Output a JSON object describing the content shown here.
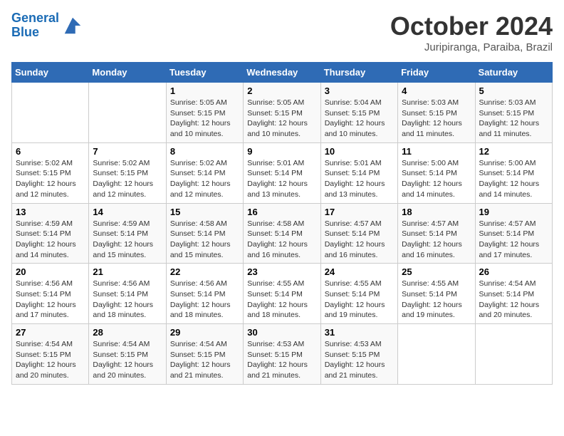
{
  "header": {
    "logo_line1": "General",
    "logo_line2": "Blue",
    "month_title": "October 2024",
    "location": "Juripiranga, Paraiba, Brazil"
  },
  "weekdays": [
    "Sunday",
    "Monday",
    "Tuesday",
    "Wednesday",
    "Thursday",
    "Friday",
    "Saturday"
  ],
  "weeks": [
    [
      {
        "day": "",
        "info": ""
      },
      {
        "day": "",
        "info": ""
      },
      {
        "day": "1",
        "info": "Sunrise: 5:05 AM\nSunset: 5:15 PM\nDaylight: 12 hours and 10 minutes."
      },
      {
        "day": "2",
        "info": "Sunrise: 5:05 AM\nSunset: 5:15 PM\nDaylight: 12 hours and 10 minutes."
      },
      {
        "day": "3",
        "info": "Sunrise: 5:04 AM\nSunset: 5:15 PM\nDaylight: 12 hours and 10 minutes."
      },
      {
        "day": "4",
        "info": "Sunrise: 5:03 AM\nSunset: 5:15 PM\nDaylight: 12 hours and 11 minutes."
      },
      {
        "day": "5",
        "info": "Sunrise: 5:03 AM\nSunset: 5:15 PM\nDaylight: 12 hours and 11 minutes."
      }
    ],
    [
      {
        "day": "6",
        "info": "Sunrise: 5:02 AM\nSunset: 5:15 PM\nDaylight: 12 hours and 12 minutes."
      },
      {
        "day": "7",
        "info": "Sunrise: 5:02 AM\nSunset: 5:15 PM\nDaylight: 12 hours and 12 minutes."
      },
      {
        "day": "8",
        "info": "Sunrise: 5:02 AM\nSunset: 5:14 PM\nDaylight: 12 hours and 12 minutes."
      },
      {
        "day": "9",
        "info": "Sunrise: 5:01 AM\nSunset: 5:14 PM\nDaylight: 12 hours and 13 minutes."
      },
      {
        "day": "10",
        "info": "Sunrise: 5:01 AM\nSunset: 5:14 PM\nDaylight: 12 hours and 13 minutes."
      },
      {
        "day": "11",
        "info": "Sunrise: 5:00 AM\nSunset: 5:14 PM\nDaylight: 12 hours and 14 minutes."
      },
      {
        "day": "12",
        "info": "Sunrise: 5:00 AM\nSunset: 5:14 PM\nDaylight: 12 hours and 14 minutes."
      }
    ],
    [
      {
        "day": "13",
        "info": "Sunrise: 4:59 AM\nSunset: 5:14 PM\nDaylight: 12 hours and 14 minutes."
      },
      {
        "day": "14",
        "info": "Sunrise: 4:59 AM\nSunset: 5:14 PM\nDaylight: 12 hours and 15 minutes."
      },
      {
        "day": "15",
        "info": "Sunrise: 4:58 AM\nSunset: 5:14 PM\nDaylight: 12 hours and 15 minutes."
      },
      {
        "day": "16",
        "info": "Sunrise: 4:58 AM\nSunset: 5:14 PM\nDaylight: 12 hours and 16 minutes."
      },
      {
        "day": "17",
        "info": "Sunrise: 4:57 AM\nSunset: 5:14 PM\nDaylight: 12 hours and 16 minutes."
      },
      {
        "day": "18",
        "info": "Sunrise: 4:57 AM\nSunset: 5:14 PM\nDaylight: 12 hours and 16 minutes."
      },
      {
        "day": "19",
        "info": "Sunrise: 4:57 AM\nSunset: 5:14 PM\nDaylight: 12 hours and 17 minutes."
      }
    ],
    [
      {
        "day": "20",
        "info": "Sunrise: 4:56 AM\nSunset: 5:14 PM\nDaylight: 12 hours and 17 minutes."
      },
      {
        "day": "21",
        "info": "Sunrise: 4:56 AM\nSunset: 5:14 PM\nDaylight: 12 hours and 18 minutes."
      },
      {
        "day": "22",
        "info": "Sunrise: 4:56 AM\nSunset: 5:14 PM\nDaylight: 12 hours and 18 minutes."
      },
      {
        "day": "23",
        "info": "Sunrise: 4:55 AM\nSunset: 5:14 PM\nDaylight: 12 hours and 18 minutes."
      },
      {
        "day": "24",
        "info": "Sunrise: 4:55 AM\nSunset: 5:14 PM\nDaylight: 12 hours and 19 minutes."
      },
      {
        "day": "25",
        "info": "Sunrise: 4:55 AM\nSunset: 5:14 PM\nDaylight: 12 hours and 19 minutes."
      },
      {
        "day": "26",
        "info": "Sunrise: 4:54 AM\nSunset: 5:14 PM\nDaylight: 12 hours and 20 minutes."
      }
    ],
    [
      {
        "day": "27",
        "info": "Sunrise: 4:54 AM\nSunset: 5:15 PM\nDaylight: 12 hours and 20 minutes."
      },
      {
        "day": "28",
        "info": "Sunrise: 4:54 AM\nSunset: 5:15 PM\nDaylight: 12 hours and 20 minutes."
      },
      {
        "day": "29",
        "info": "Sunrise: 4:54 AM\nSunset: 5:15 PM\nDaylight: 12 hours and 21 minutes."
      },
      {
        "day": "30",
        "info": "Sunrise: 4:53 AM\nSunset: 5:15 PM\nDaylight: 12 hours and 21 minutes."
      },
      {
        "day": "31",
        "info": "Sunrise: 4:53 AM\nSunset: 5:15 PM\nDaylight: 12 hours and 21 minutes."
      },
      {
        "day": "",
        "info": ""
      },
      {
        "day": "",
        "info": ""
      }
    ]
  ]
}
